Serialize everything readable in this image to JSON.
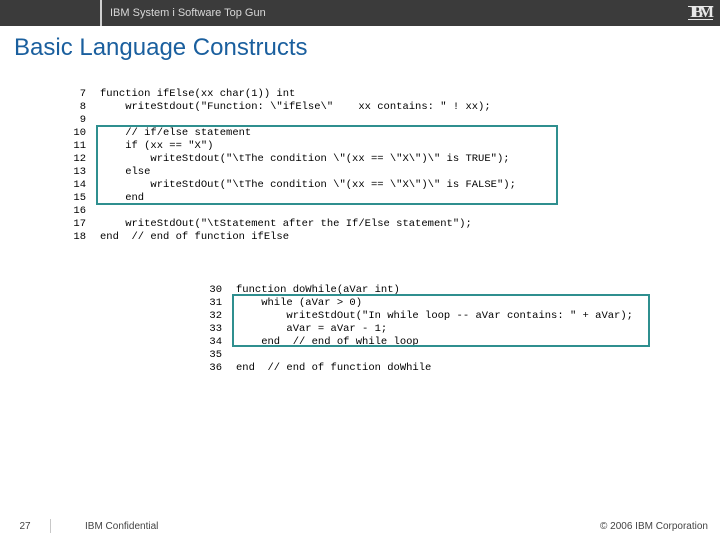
{
  "header": {
    "product": "IBM System i Software Top Gun",
    "logo_text": "IBM"
  },
  "title": "Basic Language Constructs",
  "code_block_1": {
    "lines": [
      {
        "n": "7",
        "t": "function ifElse(xx char(1)) int"
      },
      {
        "n": "8",
        "t": "    writeStdout(\"Function: \\\"ifElse\\\"    xx contains: \" ! xx);"
      },
      {
        "n": "9",
        "t": ""
      },
      {
        "n": "10",
        "t": "    // if/else statement"
      },
      {
        "n": "11",
        "t": "    if (xx == \"X\")"
      },
      {
        "n": "12",
        "t": "        writeStdout(\"\\tThe condition \\\"(xx == \\\"X\\\")\\\" is TRUE\");"
      },
      {
        "n": "13",
        "t": "    else"
      },
      {
        "n": "14",
        "t": "        writeStdOut(\"\\tThe condition \\\"(xx == \\\"X\\\")\\\" is FALSE\");"
      },
      {
        "n": "15",
        "t": "    end"
      },
      {
        "n": "16",
        "t": ""
      },
      {
        "n": "17",
        "t": "    writeStdOut(\"\\tStatement after the If/Else statement\");"
      },
      {
        "n": "18",
        "t": "end  // end of function ifElse"
      }
    ]
  },
  "code_block_2": {
    "lines": [
      {
        "n": "30",
        "t": "function doWhile(aVar int)"
      },
      {
        "n": "31",
        "t": "    while (aVar > 0)"
      },
      {
        "n": "32",
        "t": "        writeStdOut(\"In while loop -- aVar contains: \" + aVar);"
      },
      {
        "n": "33",
        "t": "        aVar = aVar - 1;"
      },
      {
        "n": "34",
        "t": "    end  // end of while loop"
      },
      {
        "n": "35",
        "t": ""
      },
      {
        "n": "36",
        "t": "end  // end of function doWhile"
      }
    ]
  },
  "footer": {
    "page": "27",
    "confidential": "IBM Confidential",
    "copyright": "© 2006  IBM Corporation"
  }
}
